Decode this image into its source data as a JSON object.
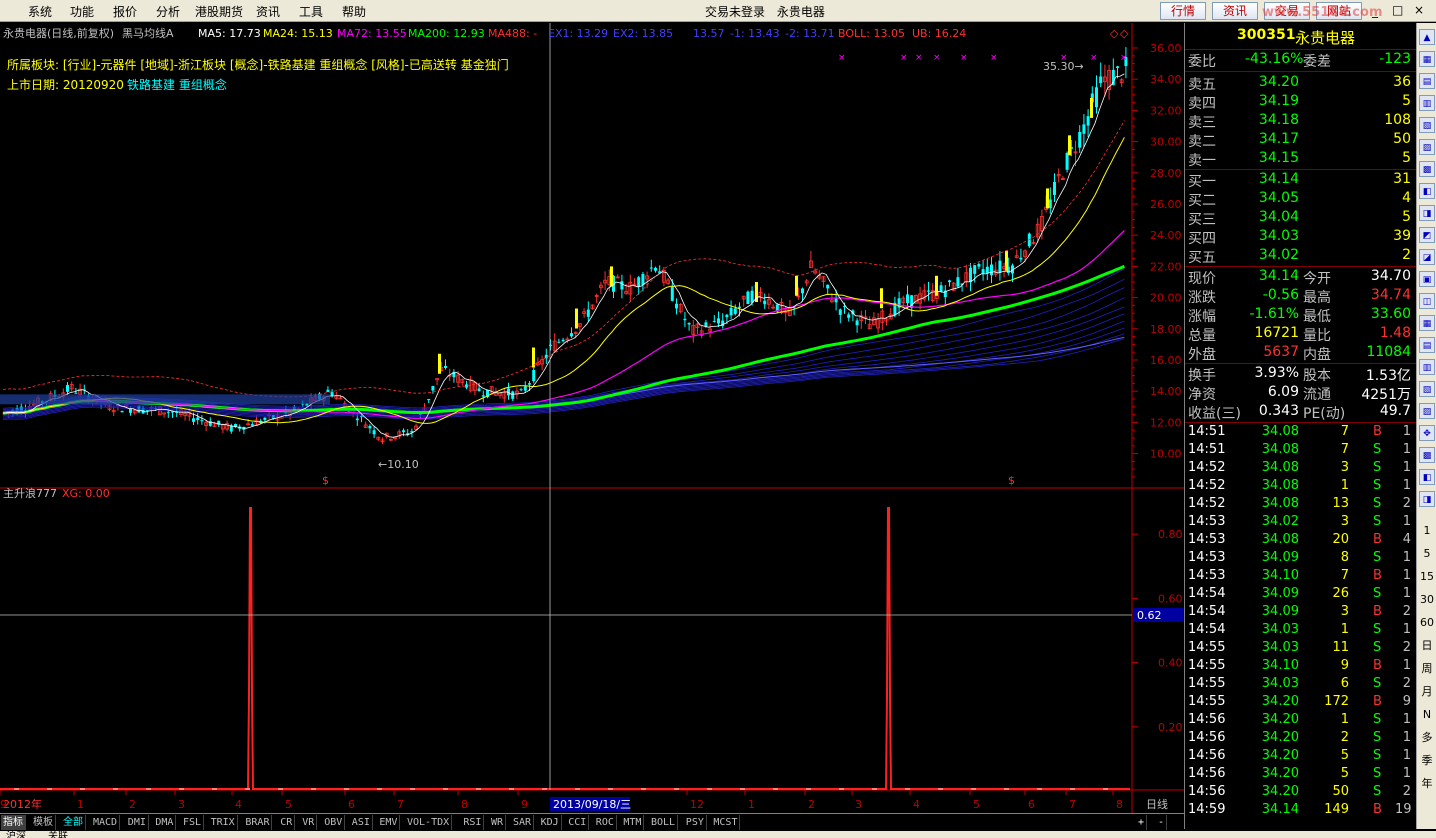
{
  "menu": [
    "系统",
    "功能",
    "报价",
    "分析",
    "港股期货",
    "资讯",
    "工具",
    "帮助"
  ],
  "title_center": [
    "交易未登录",
    "永贵电器"
  ],
  "top_buttons": [
    "行情",
    "资讯",
    "交易",
    "网站"
  ],
  "watermark": "www.55188.com",
  "chart_header": {
    "name": "永贵电器(日线,前复权)",
    "formula": "黑马均线A",
    "ma5": "MA5: 17.73",
    "ma24": "MA24: 15.13",
    "ma72": "MA72: 13.55",
    "ma200": "MA200: 12.93",
    "ma488": "MA488: -",
    "ex1": "EX1: 13.29",
    "ex2": "EX2: 13.85",
    "e3": "13.57",
    "e4": "-1: 13.43",
    "e5": "-2: 13.71",
    "boll": "BOLL: 13.05",
    "ub": "UB: 16.24"
  },
  "info_line1": "所属板块: [行业]-元器件 [地域]-浙江板块 [概念]-铁路基建 重组概念 [风格]-已高送转 基金独门",
  "info_line2_label": "上市日期: 20120920",
  "info_line2_value": "铁路基建 重组概念",
  "price_axis": [
    "36.00",
    "34.00",
    "32.00",
    "30.00",
    "28.00",
    "26.00",
    "24.00",
    "22.00",
    "20.00",
    "18.00",
    "16.00",
    "14.00",
    "12.00",
    "10.00"
  ],
  "annot_low": "10.10",
  "annot_high": "35.30",
  "sub_header": {
    "name": "主升浪777",
    "xg": "XG: 0.00"
  },
  "sub_axis": [
    "0.80",
    "0.60",
    "0.40",
    "0.20"
  ],
  "cursor_value": "0.62",
  "date_axis": {
    "year": "2012年",
    "months": [
      "1",
      "2",
      "3",
      "4",
      "5",
      "6",
      "7",
      "8",
      "9",
      "",
      "12",
      "1",
      "2",
      "3",
      "4",
      "5",
      "6",
      "7",
      "8",
      "9"
    ],
    "cursor_date": "2013/09/18/三",
    "period": "日线"
  },
  "indicator_tabs": [
    "指标",
    "模板",
    "全部",
    "MACD",
    "DMI",
    "DMA",
    "FSL",
    "TRIX",
    "BRAR",
    "CR",
    "VR",
    "OBV",
    "ASI",
    "EMV",
    "VOL-TDX",
    "RSI",
    "WR",
    "SAR",
    "KDJ",
    "CCI",
    "ROC",
    "MTM",
    "BOLL",
    "PSY",
    "MCST"
  ],
  "zoom": [
    "+",
    "-"
  ],
  "quote": {
    "code": "300351",
    "name": "永贵电器",
    "weibi_label": "委比",
    "weibi": "-43.16%",
    "weicha_label": "委差",
    "weicha": "-123",
    "asks": [
      {
        "label": "卖五",
        "price": "34.20",
        "vol": "36"
      },
      {
        "label": "卖四",
        "price": "34.19",
        "vol": "5"
      },
      {
        "label": "卖三",
        "price": "34.18",
        "vol": "108"
      },
      {
        "label": "卖二",
        "price": "34.17",
        "vol": "50"
      },
      {
        "label": "卖一",
        "price": "34.15",
        "vol": "5"
      }
    ],
    "bids": [
      {
        "label": "买一",
        "price": "34.14",
        "vol": "31"
      },
      {
        "label": "买二",
        "price": "34.05",
        "vol": "4"
      },
      {
        "label": "买三",
        "price": "34.04",
        "vol": "5"
      },
      {
        "label": "买四",
        "price": "34.03",
        "vol": "39"
      },
      {
        "label": "买五",
        "price": "34.02",
        "vol": "2"
      }
    ],
    "stats": [
      {
        "l1": "现价",
        "v1": "34.14",
        "c1": "#00ff00",
        "l2": "今开",
        "v2": "34.70",
        "c2": "#ffffff"
      },
      {
        "l1": "涨跌",
        "v1": "-0.56",
        "c1": "#00ff00",
        "l2": "最高",
        "v2": "34.74",
        "c2": "#ff3030"
      },
      {
        "l1": "涨幅",
        "v1": "-1.61%",
        "c1": "#00ff00",
        "l2": "最低",
        "v2": "33.60",
        "c2": "#00ff00"
      },
      {
        "l1": "总量",
        "v1": "16721",
        "c1": "#ffff00",
        "l2": "量比",
        "v2": "1.48",
        "c2": "#ff3030"
      },
      {
        "l1": "外盘",
        "v1": "5637",
        "c1": "#ff3030",
        "l2": "内盘",
        "v2": "11084",
        "c2": "#00ff00"
      }
    ],
    "stats2": [
      {
        "l1": "换手",
        "v1": "3.93%",
        "l2": "股本",
        "v2": "1.53亿"
      },
      {
        "l1": "净资",
        "v1": "6.09",
        "l2": "流通",
        "v2": "4251万"
      },
      {
        "l1": "收益(三)",
        "v1": "0.343",
        "l2": "PE(动)",
        "v2": "49.7"
      }
    ]
  },
  "ticks": [
    [
      "14:51",
      "34.08",
      "7",
      "B",
      "1"
    ],
    [
      "14:51",
      "34.08",
      "7",
      "S",
      "1"
    ],
    [
      "14:52",
      "34.08",
      "3",
      "S",
      "1"
    ],
    [
      "14:52",
      "34.08",
      "1",
      "S",
      "1"
    ],
    [
      "14:52",
      "34.08",
      "13",
      "S",
      "2"
    ],
    [
      "14:53",
      "34.02",
      "3",
      "S",
      "1"
    ],
    [
      "14:53",
      "34.08",
      "20",
      "B",
      "4"
    ],
    [
      "14:53",
      "34.09",
      "8",
      "S",
      "1"
    ],
    [
      "14:53",
      "34.10",
      "7",
      "B",
      "1"
    ],
    [
      "14:54",
      "34.09",
      "26",
      "S",
      "1"
    ],
    [
      "14:54",
      "34.09",
      "3",
      "B",
      "2"
    ],
    [
      "14:54",
      "34.03",
      "1",
      "S",
      "1"
    ],
    [
      "14:55",
      "34.03",
      "11",
      "S",
      "2"
    ],
    [
      "14:55",
      "34.10",
      "9",
      "B",
      "1"
    ],
    [
      "14:55",
      "34.03",
      "6",
      "S",
      "2"
    ],
    [
      "14:55",
      "34.20",
      "172",
      "B",
      "9"
    ],
    [
      "14:56",
      "34.20",
      "1",
      "S",
      "1"
    ],
    [
      "14:56",
      "34.20",
      "2",
      "S",
      "1"
    ],
    [
      "14:56",
      "34.20",
      "5",
      "S",
      "1"
    ],
    [
      "14:56",
      "34.20",
      "5",
      "S",
      "1"
    ],
    [
      "14:56",
      "34.20",
      "50",
      "S",
      "2"
    ],
    [
      "14:59",
      "34.14",
      "149",
      "B",
      "19"
    ]
  ],
  "side_toolbar": [
    "1",
    "5",
    "15",
    "30",
    "60",
    "日",
    "周",
    "月",
    "N",
    "多",
    "季",
    "年"
  ],
  "status_bar": [
    "沪深",
    "关联"
  ],
  "colors": {
    "up": "#ff3030",
    "down": "#00ffff",
    "bg": "#000000",
    "axis": "#c00000",
    "ma5": "#ffffff",
    "ma24": "#ffff00",
    "ma72": "#ff00ff",
    "ma200": "#00ff00"
  }
}
